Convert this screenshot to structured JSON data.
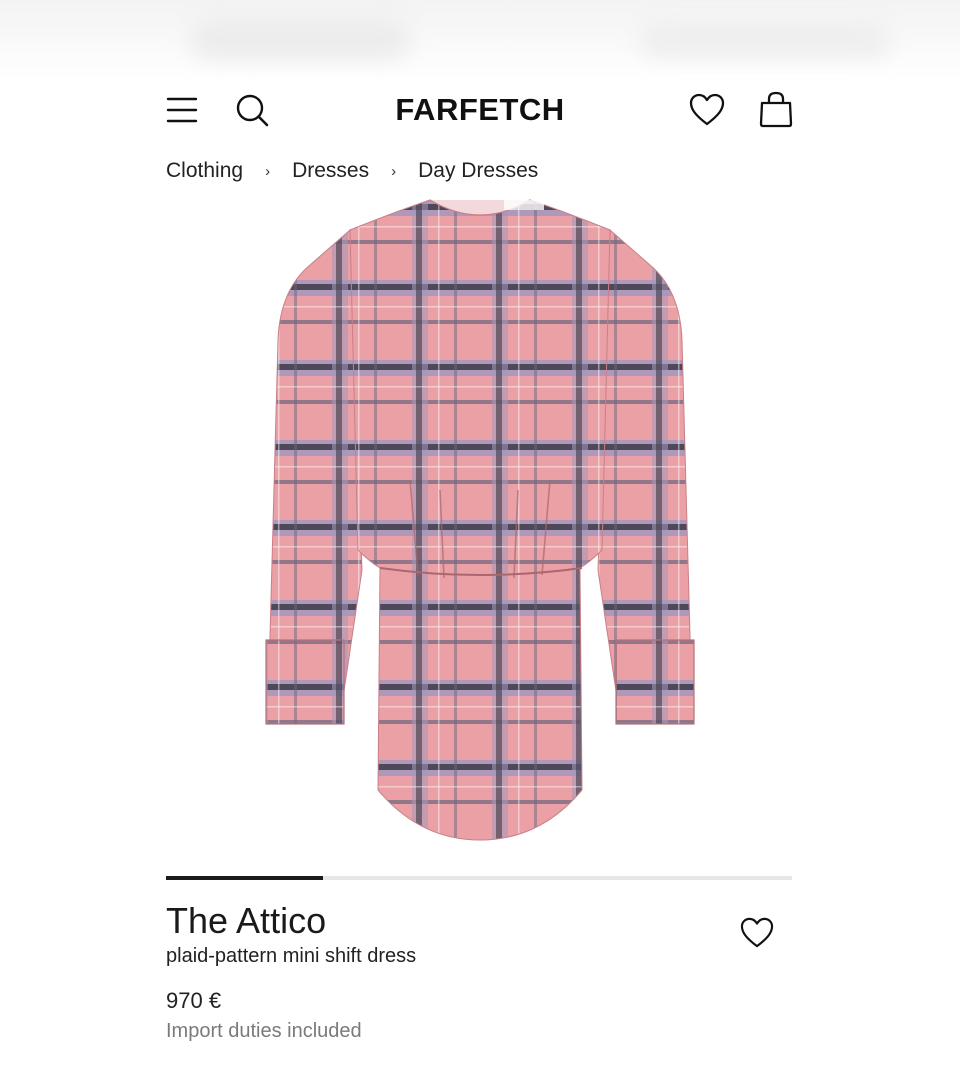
{
  "header": {
    "logo": "FARFETCH",
    "icons": {
      "menu": "menu-icon",
      "search": "search-icon",
      "wishlist": "heart-icon",
      "bag": "shopping-bag-icon"
    }
  },
  "breadcrumb": [
    "Clothing",
    "Dresses",
    "Day Dresses"
  ],
  "product": {
    "image_alt": "pink plaid long-sleeve mini dress",
    "gallery": {
      "current": 1,
      "total": 4
    },
    "brand": "The Attico",
    "name": "plaid-pattern mini shift dress",
    "price": "970 €",
    "duties_note": "Import duties included",
    "pattern_colors": {
      "base": "#e8979d",
      "check": "#9a8fb3",
      "dark": "#3d3a47"
    }
  },
  "colors": {
    "text": "#1a1a1a",
    "muted": "#7a7a7a",
    "progress_track": "#e7e7e7"
  }
}
